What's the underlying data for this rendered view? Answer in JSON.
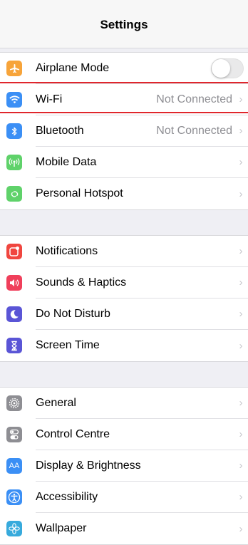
{
  "nav": {
    "title": "Settings"
  },
  "groups": [
    {
      "items": [
        {
          "name": "airplane-mode",
          "label": "Airplane Mode",
          "icon": "airplane-icon",
          "color": "#f7a43a",
          "toggle": true
        },
        {
          "name": "wifi",
          "label": "Wi-Fi",
          "value": "Not Connected",
          "icon": "wifi-icon",
          "color": "#3b8ff5"
        },
        {
          "name": "bluetooth",
          "label": "Bluetooth",
          "value": "Not Connected",
          "icon": "bluetooth-icon",
          "color": "#3b8ff5"
        },
        {
          "name": "mobile-data",
          "label": "Mobile Data",
          "icon": "antenna-icon",
          "color": "#5fd26a"
        },
        {
          "name": "personal-hotspot",
          "label": "Personal Hotspot",
          "icon": "hotspot-icon",
          "color": "#5fd26a"
        }
      ]
    },
    {
      "items": [
        {
          "name": "notifications",
          "label": "Notifications",
          "icon": "notifications-icon",
          "color": "#f0463f"
        },
        {
          "name": "sounds-haptics",
          "label": "Sounds & Haptics",
          "icon": "speaker-icon",
          "color": "#f03f5b"
        },
        {
          "name": "do-not-disturb",
          "label": "Do Not Disturb",
          "icon": "moon-icon",
          "color": "#5a55d6"
        },
        {
          "name": "screen-time",
          "label": "Screen Time",
          "icon": "hourglass-icon",
          "color": "#5a55d6"
        }
      ]
    },
    {
      "items": [
        {
          "name": "general",
          "label": "General",
          "icon": "gear-icon",
          "color": "#8e8e93"
        },
        {
          "name": "control-centre",
          "label": "Control Centre",
          "icon": "switches-icon",
          "color": "#8e8e93"
        },
        {
          "name": "display-brightness",
          "label": "Display & Brightness",
          "icon": "text-size-icon",
          "icon_text": "AA",
          "color": "#3b8ff5"
        },
        {
          "name": "accessibility",
          "label": "Accessibility",
          "icon": "accessibility-icon",
          "color": "#3b8ff5"
        },
        {
          "name": "wallpaper",
          "label": "Wallpaper",
          "icon": "flower-icon",
          "color": "#37aadc"
        }
      ]
    }
  ]
}
